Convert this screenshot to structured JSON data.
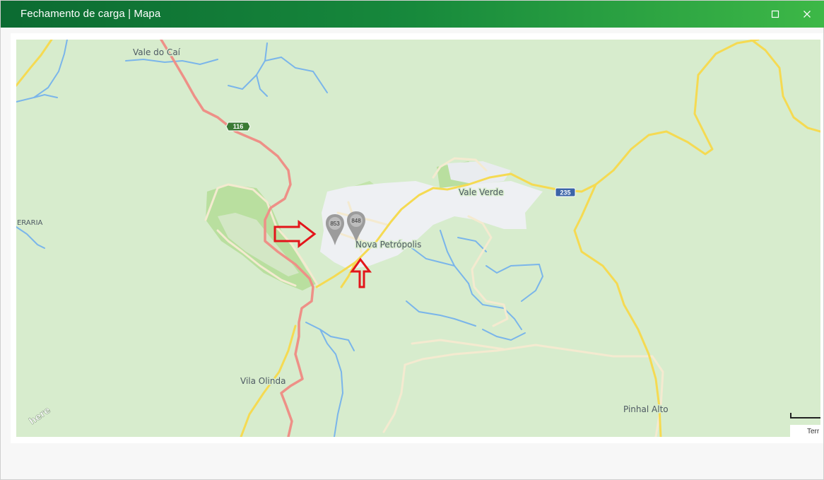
{
  "window": {
    "title": "Fechamento de carga | Mapa",
    "maximize_icon": "maximize-icon",
    "close_icon": "close-icon"
  },
  "map": {
    "provider_logo": "here",
    "places": {
      "vale_do_cai": "Vale do Caí",
      "vale_verde": "Vale Verde",
      "nova_petropolis": "Nova Petrópolis",
      "vila_olinda": "Vila Olinda",
      "pinhal_alto": "Pinhal Alto",
      "ieraria": "IERARIA"
    },
    "road_shields": {
      "br116": "116",
      "rs235": "235"
    },
    "markers": [
      {
        "label": "853",
        "icon": "map-pin-icon"
      },
      {
        "label": "848",
        "icon": "map-pin-icon"
      }
    ],
    "annotations": [
      {
        "icon": "arrow-right-icon",
        "color": "#e3151a"
      },
      {
        "icon": "arrow-up-icon",
        "color": "#e3151a"
      }
    ],
    "terrain_label": "Terr",
    "colors": {
      "land": "#d7eccd",
      "park": "#b9df9f",
      "urban": "#eef0f3",
      "water": "#7ab5ea",
      "highway": "#ee9087",
      "main_road": "#f5da52",
      "minor_road": "#f4ead0",
      "titlebar_start": "#0c6b32",
      "titlebar_end": "#3db847"
    }
  }
}
